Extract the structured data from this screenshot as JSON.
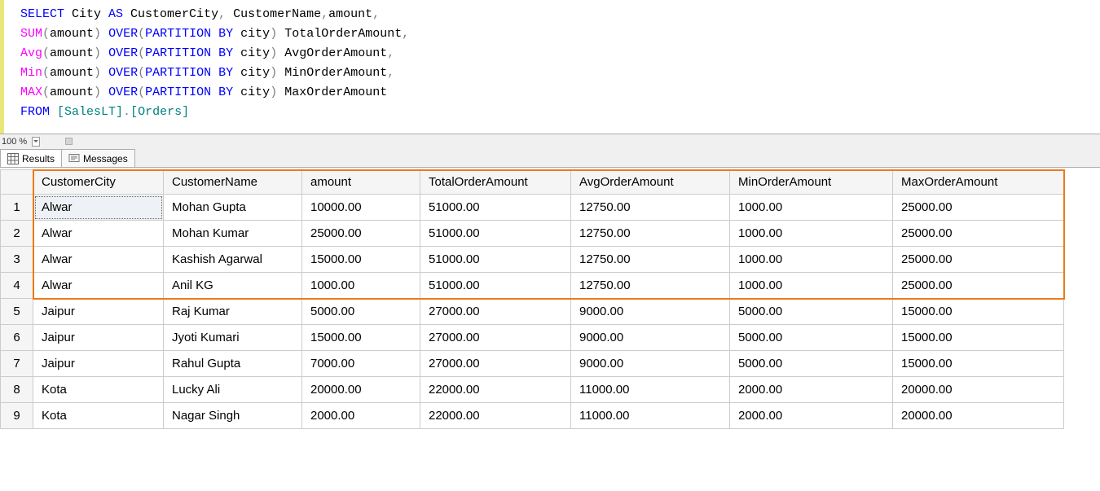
{
  "sql": {
    "line1": {
      "select": "SELECT",
      "cols1": " City ",
      "as": "AS",
      "cols2": " CustomerCity",
      "comma1": ",",
      "cols3": " CustomerName",
      "comma2": ",",
      "cols4": "amount",
      "comma3": ","
    },
    "line2": {
      "fn": "SUM",
      "paren_open": "(",
      "arg": "amount",
      "paren_close": ")",
      "space": " ",
      "over": "OVER",
      "po": "(",
      "part": "PARTITION",
      "space_b": " ",
      "by": "BY",
      "space_c": " ",
      "col": "city",
      "pc": ")",
      "alias": " TotalOrderAmount",
      "comma": ","
    },
    "line3": {
      "fn": "Avg",
      "paren_open": "(",
      "arg": "amount",
      "paren_close": ")",
      "space": " ",
      "over": "OVER",
      "po": "(",
      "part": "PARTITION",
      "space_b": " ",
      "by": "BY",
      "space_c": " ",
      "col": "city",
      "pc": ")",
      "alias": " AvgOrderAmount",
      "comma": ","
    },
    "line4": {
      "fn": "Min",
      "paren_open": "(",
      "arg": "amount",
      "paren_close": ")",
      "space": " ",
      "over": "OVER",
      "po": "(",
      "part": "PARTITION",
      "space_b": " ",
      "by": "BY",
      "space_c": " ",
      "col": "city",
      "pc": ")",
      "alias": " MinOrderAmount",
      "comma": ","
    },
    "line5": {
      "fn": "MAX",
      "paren_open": "(",
      "arg": "amount",
      "paren_close": ")",
      "space": " ",
      "over": "OVER",
      "po": "(",
      "part": "PARTITION",
      "space_b": " ",
      "by": "BY",
      "space_c": " ",
      "col": "city",
      "pc": ")",
      "alias": " MaxOrderAmount"
    },
    "line6": {
      "from": "FROM",
      "space": " ",
      "b1": "[SalesLT]",
      "dot": ".",
      "b2": "[Orders]"
    }
  },
  "zoom": {
    "label": "100 %"
  },
  "tabs": {
    "results": "Results",
    "messages": "Messages"
  },
  "grid": {
    "headers": [
      "CustomerCity",
      "CustomerName",
      "amount",
      "TotalOrderAmount",
      "AvgOrderAmount",
      "MinOrderAmount",
      "MaxOrderAmount"
    ],
    "row_nums": [
      "1",
      "2",
      "3",
      "4",
      "5",
      "6",
      "7",
      "8",
      "9"
    ],
    "rows": [
      [
        "Alwar",
        "Mohan Gupta",
        "10000.00",
        "51000.00",
        "12750.00",
        "1000.00",
        "25000.00"
      ],
      [
        "Alwar",
        "Mohan Kumar",
        "25000.00",
        "51000.00",
        "12750.00",
        "1000.00",
        "25000.00"
      ],
      [
        "Alwar",
        "Kashish Agarwal",
        "15000.00",
        "51000.00",
        "12750.00",
        "1000.00",
        "25000.00"
      ],
      [
        "Alwar",
        "Anil KG",
        "1000.00",
        "51000.00",
        "12750.00",
        "1000.00",
        "25000.00"
      ],
      [
        "Jaipur",
        "Raj Kumar",
        "5000.00",
        "27000.00",
        "9000.00",
        "5000.00",
        "15000.00"
      ],
      [
        "Jaipur",
        "Jyoti Kumari",
        "15000.00",
        "27000.00",
        "9000.00",
        "5000.00",
        "15000.00"
      ],
      [
        "Jaipur",
        "Rahul Gupta",
        "7000.00",
        "27000.00",
        "9000.00",
        "5000.00",
        "15000.00"
      ],
      [
        "Kota",
        "Lucky Ali",
        "20000.00",
        "22000.00",
        "11000.00",
        "2000.00",
        "20000.00"
      ],
      [
        "Kota",
        "Nagar Singh",
        "2000.00",
        "22000.00",
        "11000.00",
        "2000.00",
        "20000.00"
      ]
    ]
  }
}
